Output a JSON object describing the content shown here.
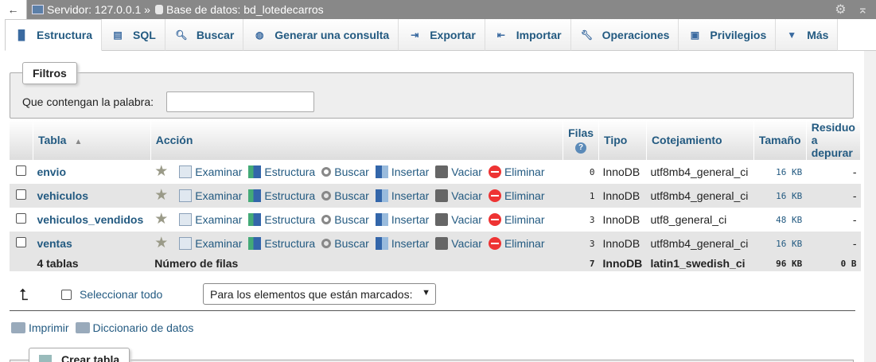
{
  "topbar": {
    "back_label": "←",
    "server": "Servidor: 127.0.0.1 »",
    "database": "Base de datos: bd_lotedecarros",
    "settings_icon": "gear-icon",
    "collapse_icon": "collapse-up-icon"
  },
  "tabs": [
    {
      "label": "Estructura",
      "icon": "structure-icon",
      "active": true
    },
    {
      "label": "SQL",
      "icon": "sql-icon"
    },
    {
      "label": "Buscar",
      "icon": "search-icon"
    },
    {
      "label": "Generar una consulta",
      "icon": "query-icon"
    },
    {
      "label": "Exportar",
      "icon": "export-icon"
    },
    {
      "label": "Importar",
      "icon": "import-icon"
    },
    {
      "label": "Operaciones",
      "icon": "wrench-icon"
    },
    {
      "label": "Privilegios",
      "icon": "privileges-icon"
    },
    {
      "label": "Más",
      "icon": "caret-down-icon"
    }
  ],
  "filters": {
    "legend": "Filtros",
    "label": "Que contengan la palabra:",
    "value": ""
  },
  "table": {
    "headers": {
      "tabla": "Tabla",
      "accion": "Acción",
      "filas": "Filas",
      "tipo": "Tipo",
      "cotejamiento": "Cotejamiento",
      "tamano": "Tamaño",
      "residuo": "Residuo a depurar"
    },
    "action_labels": {
      "examinar": "Examinar",
      "estructura": "Estructura",
      "buscar": "Buscar",
      "insertar": "Insertar",
      "vaciar": "Vaciar",
      "eliminar": "Eliminar"
    },
    "rows": [
      {
        "name": "envio",
        "rows": "0",
        "type": "InnoDB",
        "collation": "utf8mb4_general_ci",
        "size": "16 KB",
        "overhead": "-"
      },
      {
        "name": "vehiculos",
        "rows": "1",
        "type": "InnoDB",
        "collation": "utf8mb4_general_ci",
        "size": "16 KB",
        "overhead": "-"
      },
      {
        "name": "vehiculos_vendidos",
        "rows": "3",
        "type": "InnoDB",
        "collation": "utf8_general_ci",
        "size": "48 KB",
        "overhead": "-"
      },
      {
        "name": "ventas",
        "rows": "3",
        "type": "InnoDB",
        "collation": "utf8mb4_general_ci",
        "size": "16 KB",
        "overhead": "-"
      }
    ],
    "footer": {
      "count": "4 tablas",
      "label": "Número de filas",
      "rows": "7",
      "type": "InnoDB",
      "collation": "latin1_swedish_ci",
      "size": "96 KB",
      "overhead": "0 B"
    }
  },
  "bulk": {
    "select_all": "Seleccionar todo",
    "dropdown": "Para los elementos que están marcados:"
  },
  "links": {
    "print": "Imprimir",
    "dictionary": "Diccionario de datos"
  },
  "create": {
    "legend": "Crear tabla"
  }
}
